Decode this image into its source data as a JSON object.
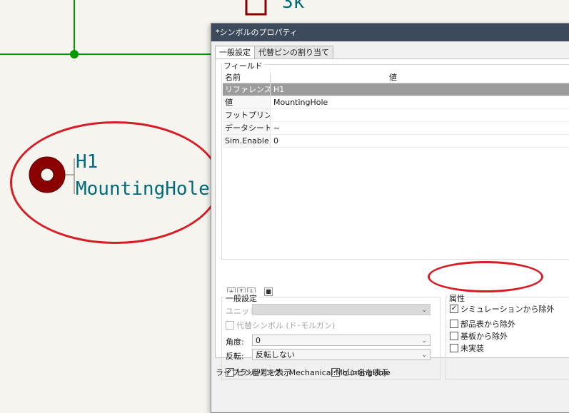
{
  "schematic": {
    "top_value": "3k",
    "reference": "H1",
    "value": "MountingHole",
    "colors": {
      "wire": "#009a00",
      "text": "#006b7a",
      "symbol": "#8b0000"
    }
  },
  "dialog": {
    "title": "*シンボルのプロパティ",
    "tabs": [
      "一般設定",
      "代替ピンの割り当て"
    ],
    "fields": {
      "group_label": "フィールド",
      "col_name": "名前",
      "col_value": "値",
      "rows": [
        {
          "name": "リファレンス",
          "value": "H1"
        },
        {
          "name": "値",
          "value": "MountingHole"
        },
        {
          "name": "フットプリント",
          "value": ""
        },
        {
          "name": "データシート",
          "value": "~"
        },
        {
          "name": "Sim.Enable",
          "value": "0"
        }
      ]
    },
    "general": {
      "group_label": "一般設定",
      "unit_label": "ユニット:",
      "alt_symbol_label": "代替シンボル (ド･モルガン)",
      "angle_label": "角度:",
      "angle_value": "0",
      "mirror_label": "反転:",
      "mirror_value": "反転しない",
      "show_pin_numbers": "ピン番号を表示",
      "show_pin_names": "ピン名を表示"
    },
    "attributes": {
      "group_label": "属性",
      "exclude_sim": "シミュレーションから除外",
      "exclude_bom": "部品表から除外",
      "exclude_board": "基板から除外",
      "dnp": "未実装"
    },
    "footer": {
      "library_link_label": "ライブラリ リンク:",
      "library_link_value": "Mechanical:MountingHole"
    }
  }
}
